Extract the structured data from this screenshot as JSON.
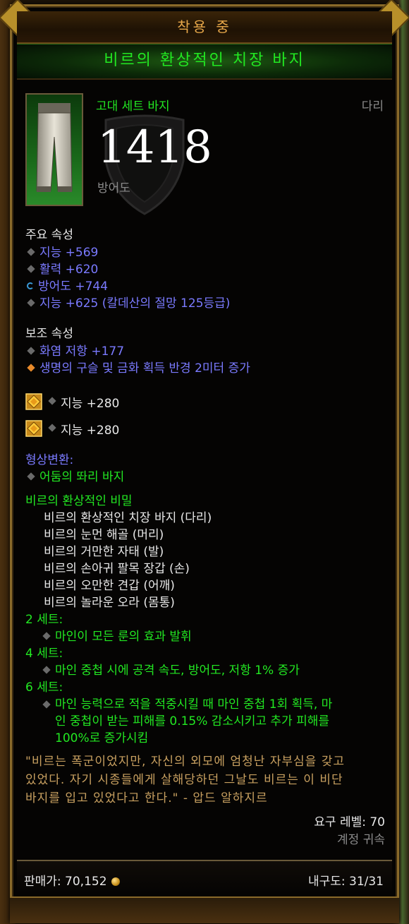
{
  "header": {
    "equipped": "착용 중",
    "item_name": "비르의 환상적인 치장 바지"
  },
  "item": {
    "type": "고대 세트 바지",
    "slot": "다리",
    "armor_value": "1418",
    "armor_label": "방어도"
  },
  "primary": {
    "title": "주요 속성",
    "stats": [
      "지능 +569",
      "활력 +620",
      "방어도 +744",
      "지능 +625 (칼데산의 절망 125등급)"
    ]
  },
  "secondary": {
    "title": "보조 속성",
    "stats": [
      "화염 저항 +177",
      "생명의 구슬 및 금화 획득 반경 2미터 증가"
    ]
  },
  "sockets": [
    "지능 +280",
    "지능 +280"
  ],
  "transmog": {
    "title": "형상변환:",
    "value": "어둠의 똬리 바지"
  },
  "set": {
    "name": "비르의 환상적인 비밀",
    "items": [
      "비르의 환상적인 치장 바지 (다리)",
      "비르의 눈먼 해골 (머리)",
      "비르의 거만한 자태 (발)",
      "비르의 손아귀 팔목 장갑 (손)",
      "비르의 오만한 견갑 (어깨)",
      "비르의 놀라운 오라 (몸통)"
    ],
    "bonuses": [
      {
        "label": "2 세트:",
        "text": "마인이 모든 룬의 효과 발휘"
      },
      {
        "label": "4 세트:",
        "text": "마인 중첩 시에 공격 속도, 방어도, 저항 1% 증가"
      },
      {
        "label": "6 세트:",
        "line1": "마인 능력으로 적을 적중시킬 때 마인 중첩 1회 획득, 마",
        "line2": "인 중첩이 받는 피해를 0.15% 감소시키고 추가 피해를",
        "line3": "100%로 증가시킴"
      }
    ]
  },
  "flavor": {
    "line1": "\"비르는 폭군이었지만, 자신의 외모에 엄청난 자부심을 갖고",
    "line2": "있었다. 자기 시종들에게 살해당하던 그날도 비르는 이 비단",
    "line3": "바지를 입고 있었다고 한다.\" - 압드 알하지르"
  },
  "requirement": "요구 레벨: 70",
  "binding": "계정 귀속",
  "footer": {
    "sell_price": "판매가: 70,152",
    "durability": "내구도: 31/31"
  },
  "colors": {
    "set_green": "#22e822",
    "magic_blue": "#7a7aff",
    "legendary_orange": "#e8a84a",
    "flavor": "#c8a060"
  },
  "icons": {
    "gem": "legendary-gem-icon",
    "coin": "gold-coin-icon",
    "armor_bg": "shield-icon"
  }
}
